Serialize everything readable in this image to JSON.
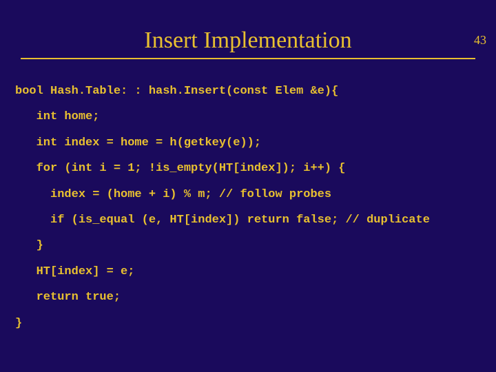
{
  "page_number": "43",
  "title": "Insert Implementation",
  "code": {
    "l0": "bool Hash.Table: : hash.Insert(const Elem &e){",
    "l1": "   int home;",
    "l2": "   int index = home = h(getkey(e));",
    "l3": "   for (int i = 1; !is_empty(HT[index]); i++) {",
    "l4": "     index = (home + i) % m; // follow probes",
    "l5": "     if (is_equal (e, HT[index]) return false; // duplicate",
    "l6": "   }",
    "l7": "   HT[index] = e;",
    "l8": "   return true;",
    "l9": "}"
  }
}
